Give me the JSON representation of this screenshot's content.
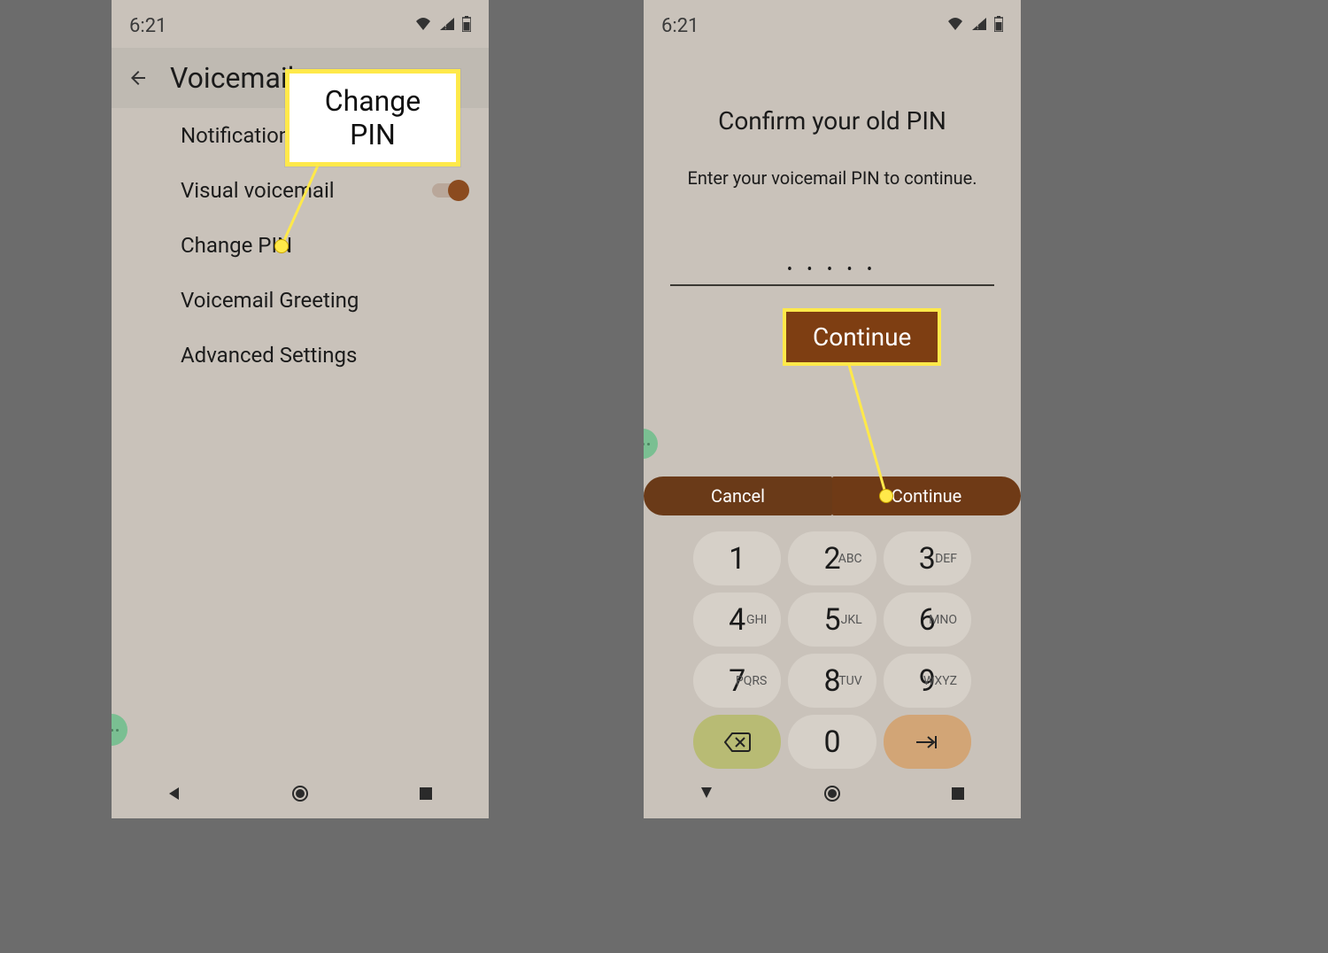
{
  "status": {
    "time": "6:21"
  },
  "left": {
    "title": "Voicemail",
    "items": [
      {
        "label": "Notifications",
        "toggle": false
      },
      {
        "label": "Visual voicemail",
        "toggle": true
      },
      {
        "label": "Change PIN",
        "toggle": false
      },
      {
        "label": "Voicemail Greeting",
        "toggle": false
      },
      {
        "label": "Advanced Settings",
        "toggle": false
      }
    ]
  },
  "right": {
    "title": "Confirm your old PIN",
    "subtitle": "Enter your voicemail PIN to continue.",
    "pin_mask": "• • • • •",
    "cancel": "Cancel",
    "continue": "Continue"
  },
  "keypad": [
    {
      "d": "1",
      "l": ""
    },
    {
      "d": "2",
      "l": "ABC"
    },
    {
      "d": "3",
      "l": "DEF"
    },
    {
      "d": "4",
      "l": "GHI"
    },
    {
      "d": "5",
      "l": "JKL"
    },
    {
      "d": "6",
      "l": "MNO"
    },
    {
      "d": "7",
      "l": "PQRS"
    },
    {
      "d": "8",
      "l": "TUV"
    },
    {
      "d": "9",
      "l": "WXYZ"
    },
    {
      "d": "",
      "l": ""
    },
    {
      "d": "0",
      "l": ""
    },
    {
      "d": "",
      "l": ""
    }
  ],
  "callouts": {
    "change_pin": "Change PIN",
    "continue": "Continue"
  }
}
